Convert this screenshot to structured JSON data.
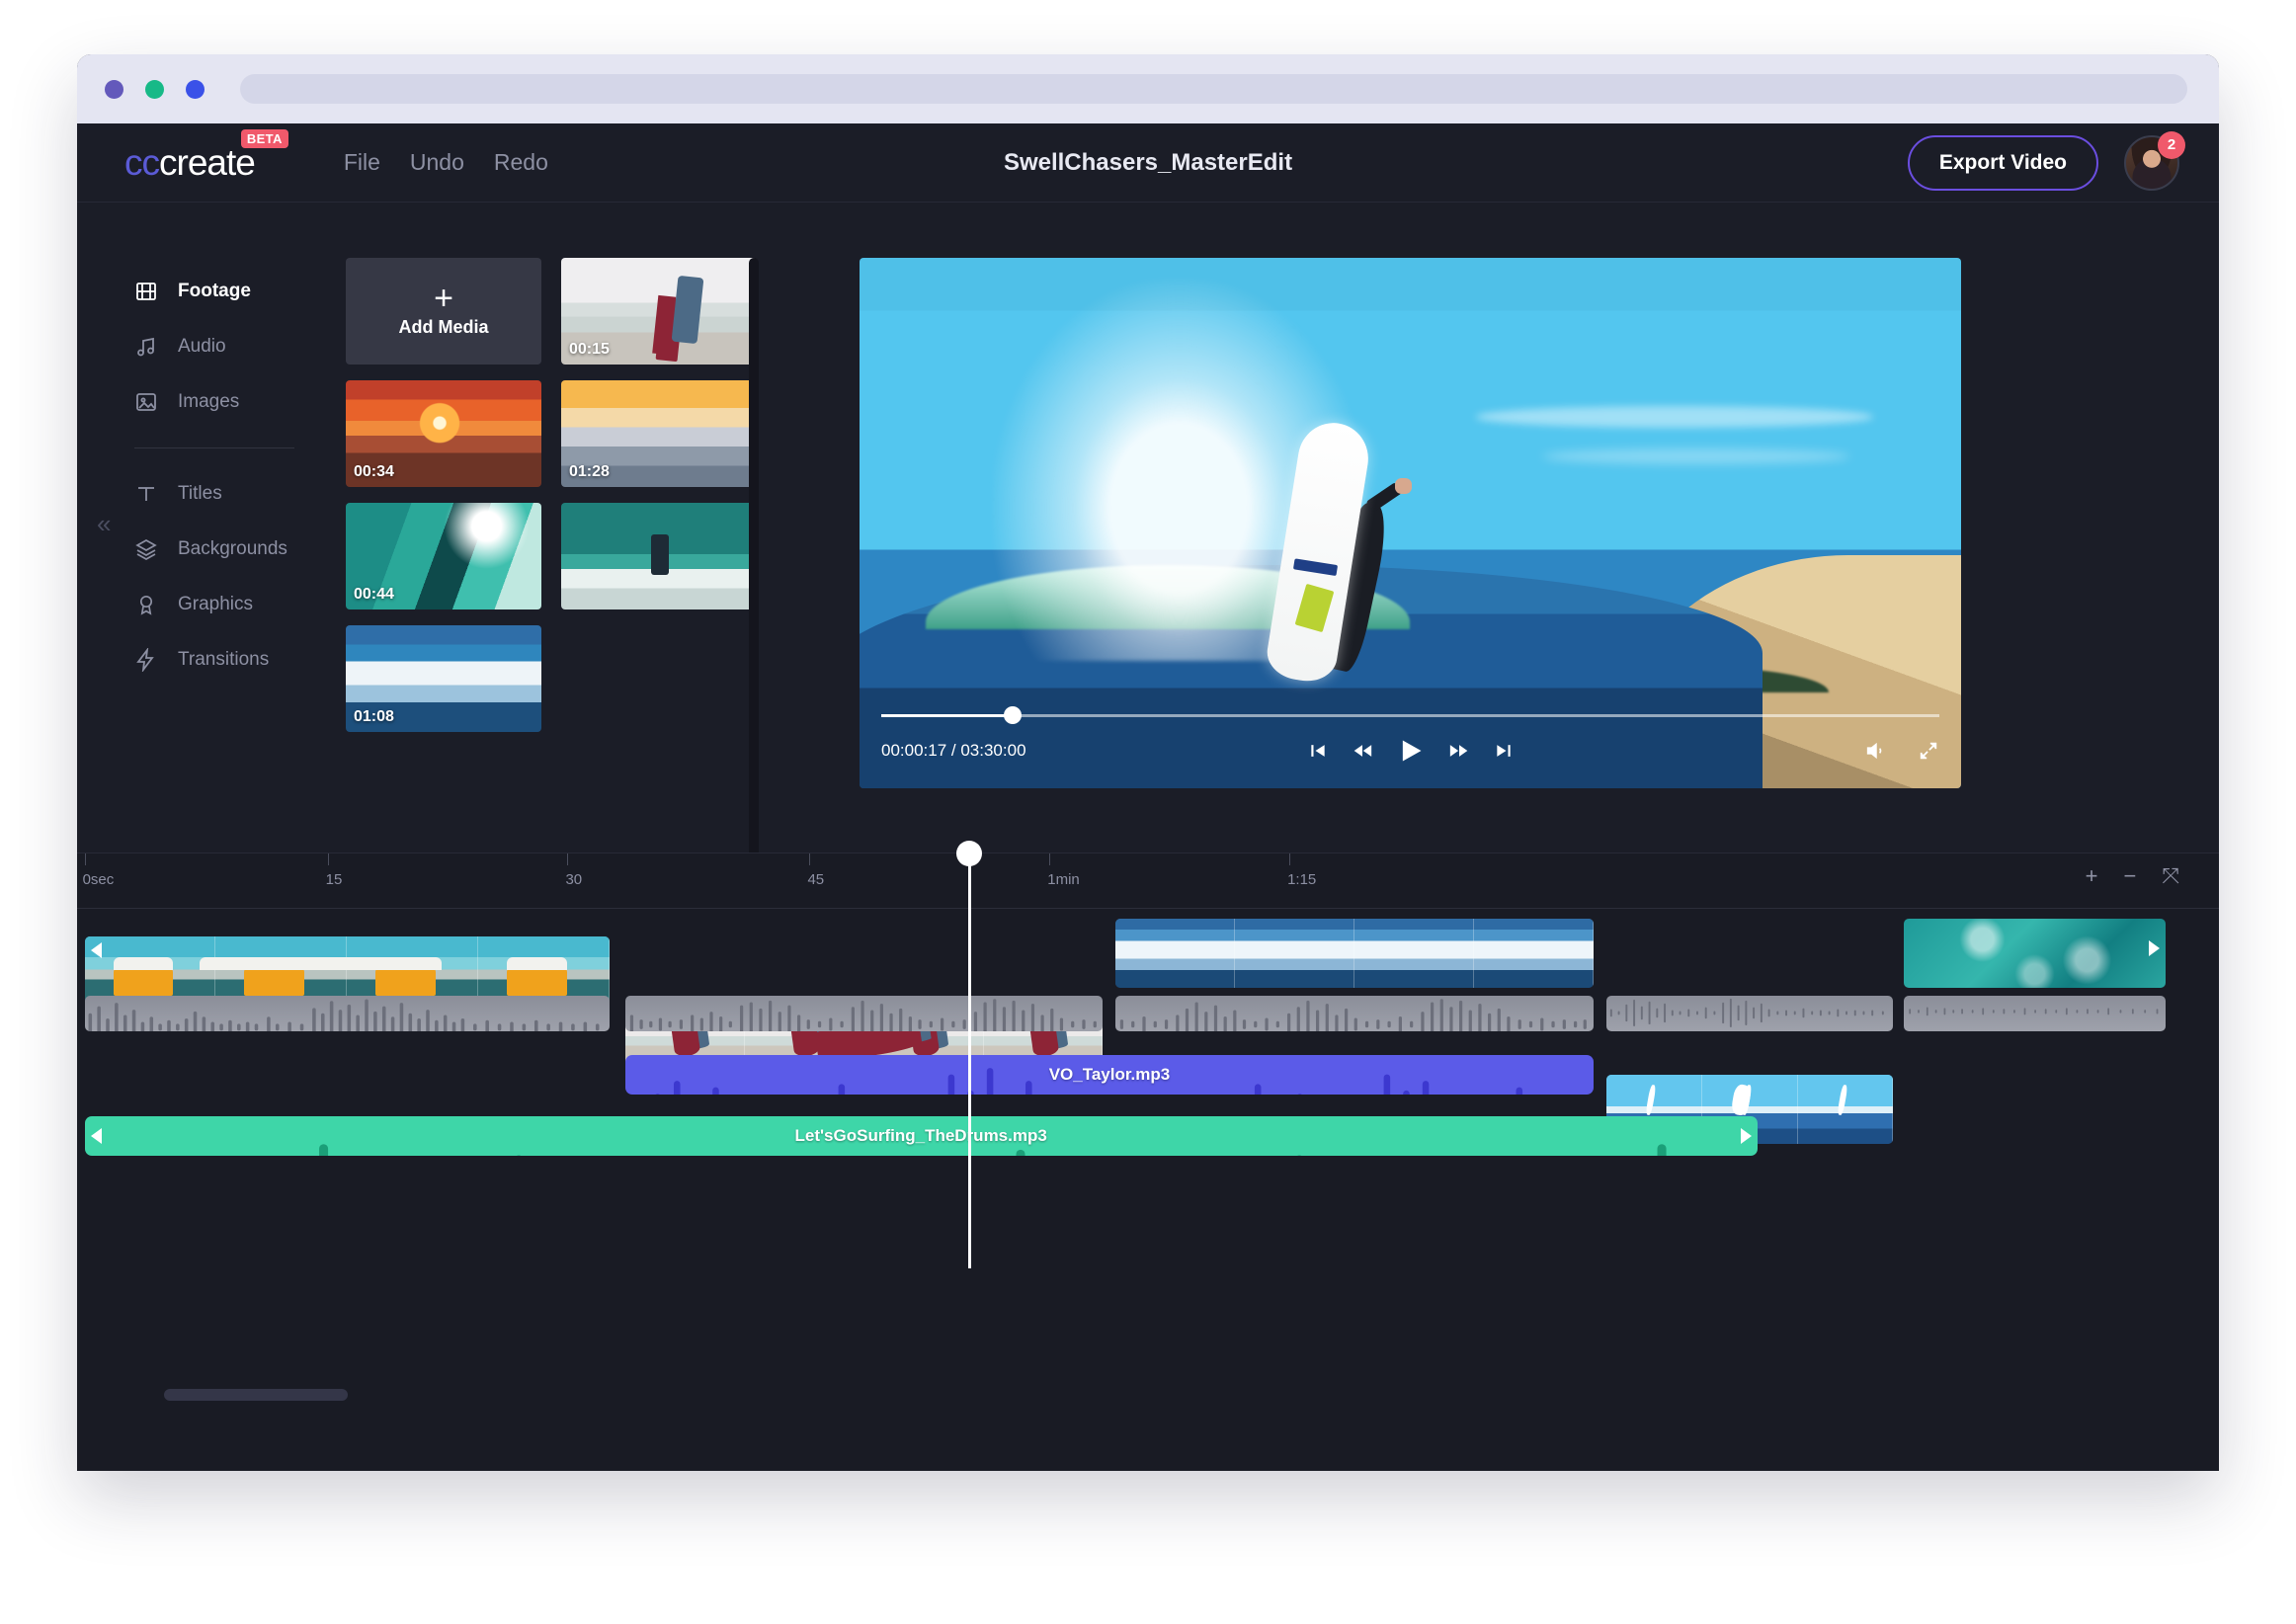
{
  "browser": {
    "dots": [
      "purple",
      "green",
      "blue"
    ],
    "url_value": "",
    "url_placeholder": ""
  },
  "header": {
    "logo_prefix": "cc",
    "logo_suffix": "create",
    "beta_badge": "BETA",
    "menu": [
      {
        "label": "File",
        "name": "menu-file"
      },
      {
        "label": "Undo",
        "name": "menu-undo"
      },
      {
        "label": "Redo",
        "name": "menu-redo"
      }
    ],
    "project_title": "SwellChasers_MasterEdit",
    "export_label": "Export Video",
    "avatar_badge_count": "2",
    "accent_purple": "#6b4ee0",
    "badge_red": "#f0596b"
  },
  "sidebar": {
    "collapse_icon": "«",
    "items": [
      {
        "label": "Footage",
        "icon": "film-icon",
        "active": true
      },
      {
        "label": "Audio",
        "icon": "music-note-icon",
        "active": false
      },
      {
        "label": "Images",
        "icon": "image-icon",
        "active": false
      },
      {
        "label": "Titles",
        "icon": "text-icon",
        "active": false
      },
      {
        "label": "Backgrounds",
        "icon": "layers-icon",
        "active": false
      },
      {
        "label": "Graphics",
        "icon": "award-icon",
        "active": false
      },
      {
        "label": "Transitions",
        "icon": "lightning-icon",
        "active": false
      }
    ]
  },
  "media_panel": {
    "add_media_label": "Add Media",
    "add_media_icon": "plus-icon",
    "items": [
      {
        "duration": "00:15",
        "art": "th-surfer-walk",
        "name": "media-thumb-surfer-walk"
      },
      {
        "duration": "00:34",
        "art": "th-sunset",
        "name": "media-thumb-sunset"
      },
      {
        "duration": "01:28",
        "art": "th-dawn",
        "name": "media-thumb-dawn"
      },
      {
        "duration": "00:44",
        "art": "th-barrel",
        "name": "media-thumb-barrel"
      },
      {
        "duration": "",
        "art": "th-teal-wave",
        "name": "media-thumb-teal-wave"
      },
      {
        "duration": "01:08",
        "art": "th-blue-wave",
        "name": "media-thumb-blue-wave"
      }
    ]
  },
  "preview": {
    "current_time": "00:00:17",
    "total_time": "03:30:00",
    "timecode": "00:00:17 / 03:30:00",
    "progress_percent": 12.4,
    "controls": [
      {
        "name": "skip-to-start-icon",
        "label": "skip to start"
      },
      {
        "name": "rewind-icon",
        "label": "rewind"
      },
      {
        "name": "play-icon",
        "label": "play"
      },
      {
        "name": "fast-forward-icon",
        "label": "fast forward"
      },
      {
        "name": "skip-to-end-icon",
        "label": "skip to end"
      }
    ],
    "volume_icon": "volume-icon",
    "fullscreen_icon": "fullscreen-icon"
  },
  "timeline": {
    "ruler_ticks": [
      {
        "label": "0sec",
        "pos_pct": 0.35
      },
      {
        "label": "15",
        "pos_pct": 11.7
      },
      {
        "label": "30",
        "pos_pct": 22.9
      },
      {
        "label": "45",
        "pos_pct": 34.2
      },
      {
        "label": "1min",
        "pos_pct": 45.4
      },
      {
        "label": "1:15",
        "pos_pct": 56.6
      }
    ],
    "zoom_controls": [
      {
        "glyph": "+",
        "name": "zoom-in-button"
      },
      {
        "glyph": "−",
        "name": "zoom-out-button"
      },
      {
        "glyph": "⤧",
        "name": "fit-to-timeline-button"
      }
    ],
    "playhead_pos_pct": 41.6,
    "video_clips": [
      {
        "name": "clip-vw-bus",
        "art": "art-bus",
        "left_pct": 0.35,
        "width_pct": 24.5,
        "frames": 4,
        "handle": "left"
      },
      {
        "name": "clip-surfer-walk",
        "art": "art-walk",
        "left_pct": 25.6,
        "width_pct": 22.3,
        "frames": 4,
        "handle": "none"
      },
      {
        "name": "clip-blue-wave",
        "art": "art-blue",
        "left_pct": 48.5,
        "width_pct": 22.3,
        "frames": 4,
        "handle": "none"
      },
      {
        "name": "clip-aerial",
        "art": "art-aerial",
        "left_pct": 71.4,
        "width_pct": 13.4,
        "frames": 3,
        "handle": "none"
      },
      {
        "name": "clip-foam",
        "art": "art-foam",
        "left_pct": 85.3,
        "width_pct": 12.2,
        "frames": 1,
        "handle": "right"
      }
    ],
    "audio_clips": [
      {
        "name": "audio-clip-voiceover",
        "label": "VO_Taylor.mp3",
        "color": "#5b5be8",
        "left_pct": 25.6,
        "width_pct": 45.2,
        "track": "vo"
      },
      {
        "name": "audio-clip-music",
        "label": "Let'sGoSurfing_TheDrums.mp3",
        "color": "#3ed6a8",
        "left_pct": 0.35,
        "width_pct": 78.1,
        "track": "music"
      }
    ]
  }
}
